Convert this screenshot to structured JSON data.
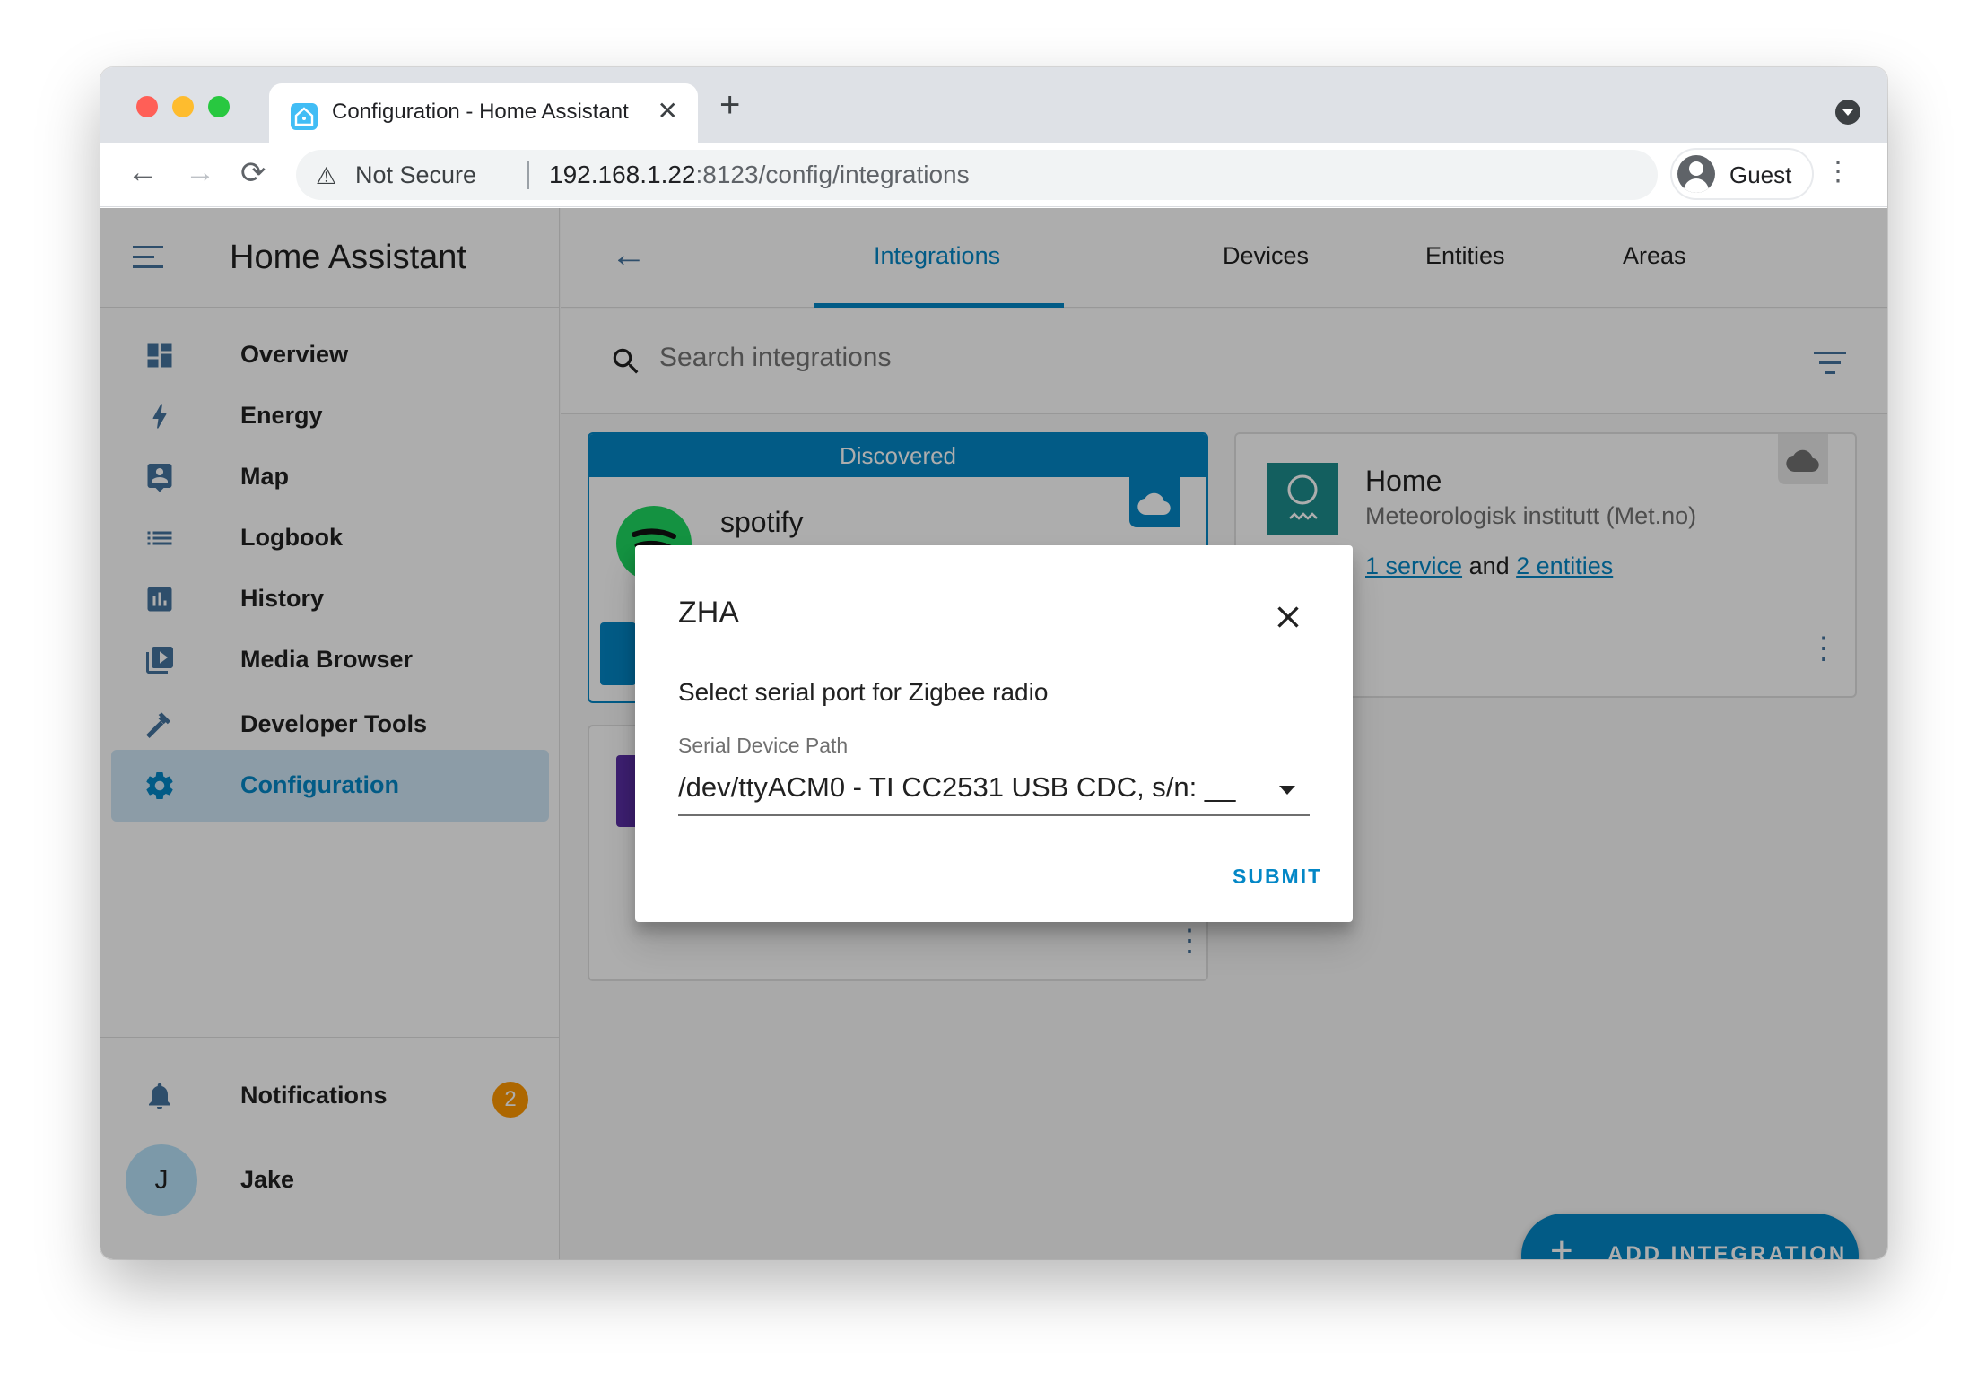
{
  "browser": {
    "tab_title": "Configuration - Home Assistant",
    "security_label": "Not Secure",
    "url_host": "192.168.1.22",
    "url_rest": ":8123/config/integrations",
    "profile_label": "Guest"
  },
  "sidebar": {
    "title": "Home Assistant",
    "items": [
      {
        "label": "Overview",
        "icon": "dashboard-icon"
      },
      {
        "label": "Energy",
        "icon": "lightning-icon"
      },
      {
        "label": "Map",
        "icon": "map-icon"
      },
      {
        "label": "Logbook",
        "icon": "list-icon"
      },
      {
        "label": "History",
        "icon": "chart-icon"
      },
      {
        "label": "Media Browser",
        "icon": "media-icon"
      },
      {
        "label": "Developer Tools",
        "icon": "hammer-icon"
      },
      {
        "label": "Configuration",
        "icon": "gear-icon",
        "active": true
      }
    ],
    "notifications": {
      "label": "Notifications",
      "count": "2"
    },
    "user": {
      "name": "Jake",
      "initial": "J"
    }
  },
  "header": {
    "tabs": [
      "Integrations",
      "Devices",
      "Entities",
      "Areas"
    ],
    "active_tab": "Integrations"
  },
  "search": {
    "placeholder": "Search integrations"
  },
  "cards": {
    "discovered": {
      "header": "Discovered",
      "name": "spotify"
    },
    "met": {
      "title": "Home",
      "subtitle": "Meteorologisk institutt (Met.no)",
      "services_link": "1 service",
      "and_text": "and",
      "entities_link": "2 entities"
    }
  },
  "fab": {
    "label": "ADD INTEGRATION"
  },
  "dialog": {
    "title": "ZHA",
    "description": "Select serial port for Zigbee radio",
    "field_label": "Serial Device Path",
    "field_value": "/dev/ttyACM0 - TI CC2531 USB CDC, s/n: __",
    "submit_label": "SUBMIT"
  },
  "colors": {
    "primary": "#0387c6",
    "sidebar_icon": "#44739e",
    "badge": "#ff9800",
    "met_logo": "#1c8c8c",
    "spotify": "#1ed760"
  }
}
